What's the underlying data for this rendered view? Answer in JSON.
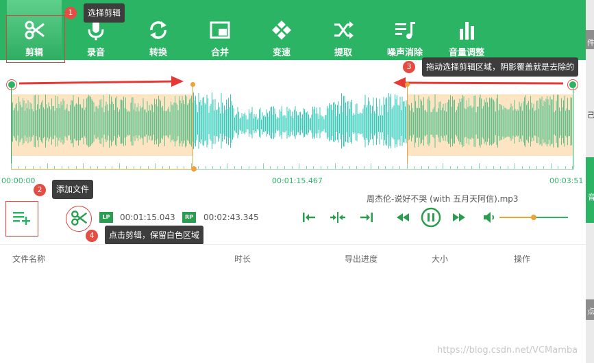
{
  "toolbar": {
    "items": [
      {
        "label": "剪辑",
        "icon": "scissors-icon"
      },
      {
        "label": "录音",
        "icon": "microphone-icon"
      },
      {
        "label": "转换",
        "icon": "convert-icon"
      },
      {
        "label": "合并",
        "icon": "merge-icon"
      },
      {
        "label": "变速",
        "icon": "speed-icon"
      },
      {
        "label": "提取",
        "icon": "shuffle-icon"
      },
      {
        "label": "噪声消除",
        "icon": "noise-icon"
      },
      {
        "label": "音量调整",
        "icon": "volume-bars-icon"
      }
    ]
  },
  "annotations": {
    "one": {
      "num": "1",
      "text": "选择剪辑"
    },
    "two": {
      "num": "2",
      "text": "添加文件"
    },
    "three": {
      "num": "3",
      "text": "拖动选择剪辑区域，阴影覆盖就是去除的"
    },
    "four": {
      "num": "4",
      "text": "点击剪辑，保留白色区域"
    }
  },
  "timeline": {
    "start": "00:00:00",
    "middle": "00:01:15.467",
    "end": "00:03:51"
  },
  "player": {
    "filename": "周杰伦-说好不哭 (with 五月天阿信).mp3",
    "lp_tag": "LP",
    "lp_time": "00:01:15.043",
    "rp_tag": "RP",
    "rp_time": "00:02:43.345",
    "volume_level": 0.5
  },
  "table": {
    "headers": [
      "文件名称",
      "时长",
      "导出进度",
      "大小",
      "操作"
    ]
  },
  "right_edge": {
    "a": "件",
    "b": "己/",
    "c": "音",
    "d": "点"
  },
  "watermark": "https://blog.csdn.net/VCMamba",
  "colors": {
    "brand_green": "#2ab463",
    "wave_teal": "#34c9b8",
    "shade_orange": "#fde4c3",
    "marker_orange": "#eba33b",
    "annotation_red": "#e54d42"
  }
}
